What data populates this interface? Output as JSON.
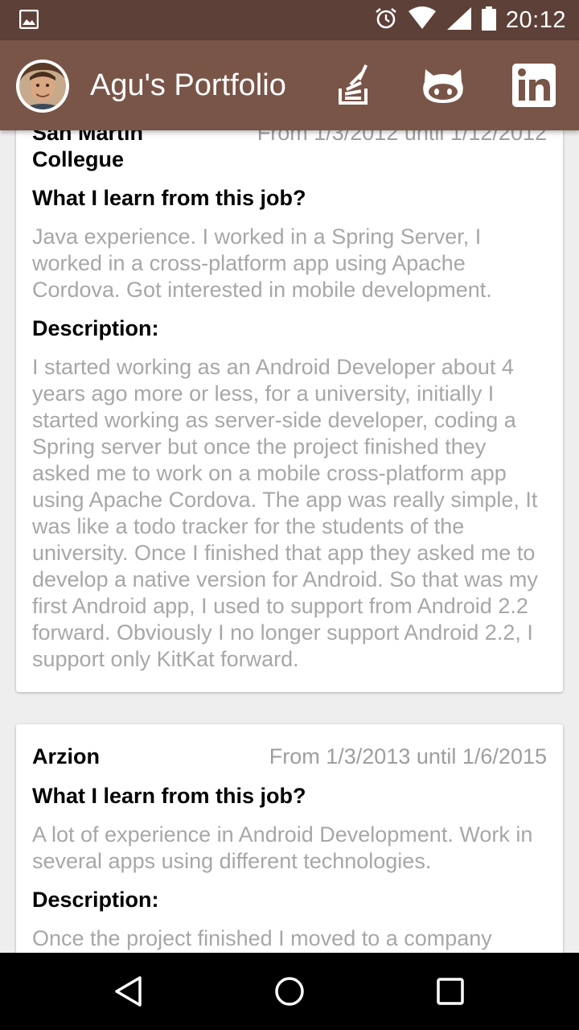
{
  "status_bar": {
    "time": "20:12",
    "icons": [
      "image-icon",
      "alarm-icon",
      "wifi-icon",
      "signal-icon",
      "battery-icon"
    ]
  },
  "toolbar": {
    "title": "Agu's Portfolio",
    "actions": [
      "stackoverflow-icon",
      "github-icon",
      "linkedin-icon"
    ],
    "colors": {
      "primary_dark": "#5d4037",
      "primary": "#795548"
    }
  },
  "jobs": [
    {
      "company": "San Martin Collegue",
      "dates": "From 1/3/2012 until 1/12/2012",
      "learned_label": "What I learn from this job?",
      "learned": "Java experience. I worked in a Spring Server, I worked in a cross-platform app using Apache Cordova. Got interested in mobile development.",
      "description_label": "Description:",
      "description": "I started working as an Android Developer about 4 years ago more or less, for a university, initially I started working as server-side developer, coding a Spring server but once the project finished they asked me to work on a mobile cross-platform app using Apache Cordova. The app was really simple, It was like a todo tracker for the students of the university. Once I finished that app they asked me to develop a native version for Android. So that was my first Android app, I used to support from Android 2.2 forward. Obviously I no longer support Android 2.2, I support only KitKat forward."
    },
    {
      "company": "Arzion",
      "dates": "From 1/3/2013 until 1/6/2015",
      "learned_label": "What I learn from this job?",
      "learned": "A lot of experience in Android Development. Work in several apps using different technologies.",
      "description_label": "Description:",
      "description": "Once the project finished I moved to a company"
    }
  ],
  "nav_bar": {
    "buttons": [
      "back-icon",
      "home-icon",
      "recents-icon"
    ]
  }
}
